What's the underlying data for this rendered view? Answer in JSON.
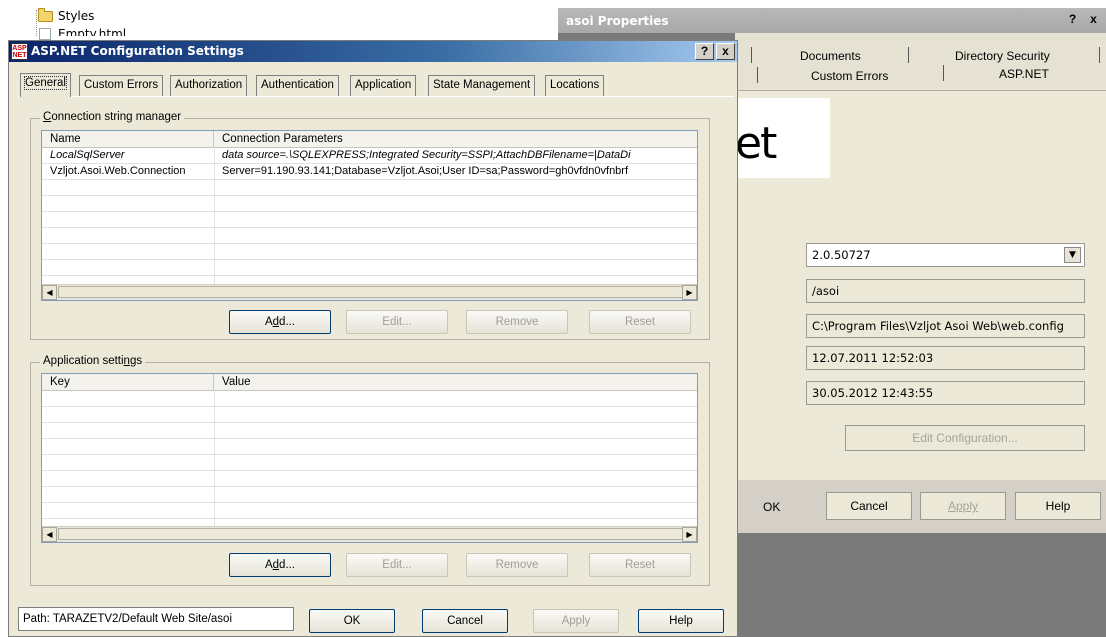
{
  "explorer": {
    "items": [
      {
        "label": "Styles",
        "icon": "folder-icon"
      },
      {
        "label": "Empty.html",
        "icon": "file-icon"
      }
    ]
  },
  "properties_window": {
    "title": "asoi Properties",
    "help_glyph": "?",
    "close_glyph": "x",
    "tabs_row1": [
      "Documents",
      "Directory Security"
    ],
    "tabs_row2": [
      "Custom Errors",
      "ASP.NET"
    ],
    "logo_text": "et",
    "version_select": "2.0.50727",
    "virtual_path": "/asoi",
    "file_location": "C:\\Program Files\\Vzljot Asoi Web\\web.config",
    "created": "12.07.2011 12:52:03",
    "modified": "30.05.2012 12:43:55",
    "edit_configuration_label": "Edit Configuration...",
    "buttons": {
      "ok": "OK",
      "cancel": "Cancel",
      "apply": "Apply",
      "help": "Help"
    }
  },
  "dialog": {
    "logo_text": "ASP NET",
    "title": "ASP.NET Configuration Settings",
    "help_glyph": "?",
    "close_glyph": "x",
    "tabs": [
      "General",
      "Custom Errors",
      "Authorization",
      "Authentication",
      "Application",
      "State Management",
      "Locations"
    ],
    "connection_group": {
      "label": "Connection string manager",
      "columns": [
        "Name",
        "Connection Parameters"
      ],
      "rows": [
        {
          "name": "LocalSqlServer",
          "params": "data source=.\\SQLEXPRESS;Integrated Security=SSPI;AttachDBFilename=|DataDi"
        },
        {
          "name": "Vzljot.Asoi.Web.Connection",
          "params": "Server=91.190.93.141;Database=Vzljot.Asoi;User ID=sa;Password=gh0vfdn0vfnbrf"
        }
      ],
      "buttons": {
        "add_prefix": "A",
        "add_underlined": "d",
        "add_suffix": "d...",
        "edit": "Edit...",
        "remove": "Remove",
        "reset": "Reset"
      }
    },
    "app_settings_group": {
      "label_prefix": "Application setti",
      "label_underlined": "n",
      "label_suffix": "gs",
      "columns": [
        "Key",
        "Value"
      ],
      "rows": [],
      "buttons": {
        "add_prefix": "A",
        "add_underlined": "d",
        "add_suffix": "d...",
        "edit": "Edit...",
        "remove": "Remove",
        "reset": "Reset"
      }
    },
    "path_status": "Path: TARAZETV2/Default Web Site/asoi",
    "buttons": {
      "ok": "OK",
      "cancel": "Cancel",
      "apply": "Apply",
      "help": "Help"
    }
  },
  "scroll_glyphs": {
    "left": "◀",
    "right": "▶",
    "down": "▼"
  }
}
